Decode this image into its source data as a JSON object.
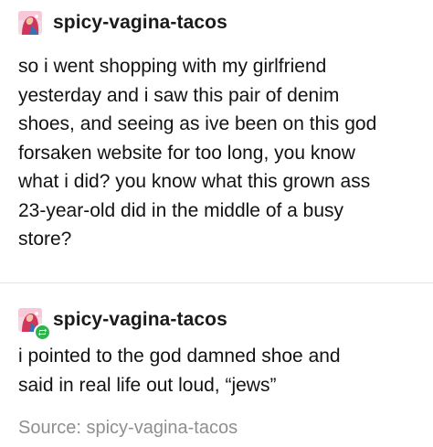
{
  "post1": {
    "username": "spicy-vagina-tacos",
    "text": "so i went shopping with my girlfriend\nyesterday and i saw this pair of denim\nshoes, and seeing as ive been on this god\nforsaken website for too long, you know\nwhat i did? you know what this grown ass\n23-year-old did in the middle of a busy\nstore?"
  },
  "post2": {
    "username": "spicy-vagina-tacos",
    "text": "i pointed to the god damned shoe and\nsaid in real life out loud, “jews”"
  },
  "source": {
    "label": "Source:",
    "name": "spicy-vagina-tacos"
  },
  "colors": {
    "text": "#121212",
    "muted": "#8f8f8f",
    "reblog": "#30b24d",
    "divider": "#e4e4e4"
  },
  "icons": {
    "avatar": "avatar-image",
    "reblog": "reblog-icon"
  }
}
